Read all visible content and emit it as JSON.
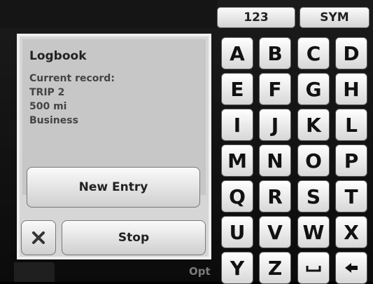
{
  "keyboard": {
    "mode_buttons": [
      "123",
      "SYM"
    ],
    "rows": [
      [
        "A",
        "B",
        "C",
        "D"
      ],
      [
        "E",
        "F",
        "G",
        "H"
      ],
      [
        "I",
        "J",
        "K",
        "L"
      ],
      [
        "M",
        "N",
        "O",
        "P"
      ],
      [
        "Q",
        "R",
        "S",
        "T"
      ],
      [
        "U",
        "V",
        "W",
        "X"
      ],
      [
        "Y",
        "Z",
        "space",
        "backspace"
      ]
    ]
  },
  "dialog": {
    "title": "Logbook",
    "current_record_label": "Current record:",
    "trip": "TRIP 2",
    "distance": "500 mi",
    "category": "Business",
    "new_entry_label": "New Entry",
    "stop_label": "Stop"
  },
  "background": {
    "partial_label": "Opt"
  },
  "icons": {
    "close": "close-icon",
    "space": "space-icon",
    "backspace": "backspace-icon"
  }
}
